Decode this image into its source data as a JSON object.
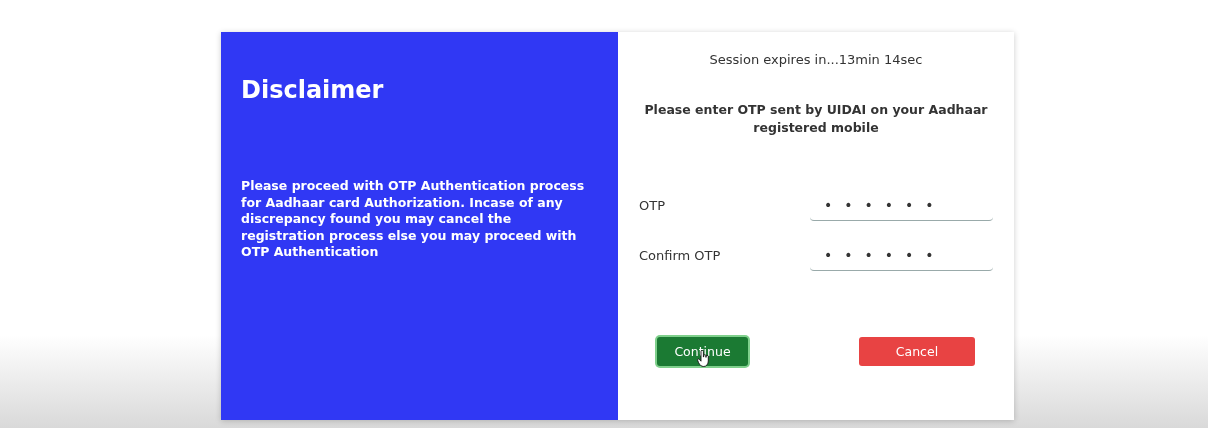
{
  "disclaimer": {
    "title": "Disclaimer",
    "text": "Please proceed with OTP Authentication process for Aadhaar card Authorization. Incase of any discrepancy found you may cancel the registration process else you may proceed with OTP Authentication"
  },
  "session": {
    "text": "Session expires in...13min 14sec"
  },
  "instruction": "Please enter OTP sent by UIDAI on your Aadhaar registered mobile",
  "fields": [
    {
      "label": "OTP",
      "value": "••••••"
    },
    {
      "label": "Confirm OTP",
      "value": "••••••"
    }
  ],
  "buttons": [
    {
      "label": "Continue",
      "kind": "primary",
      "hovered": true
    },
    {
      "label": "Cancel",
      "kind": "danger",
      "hovered": false
    }
  ]
}
